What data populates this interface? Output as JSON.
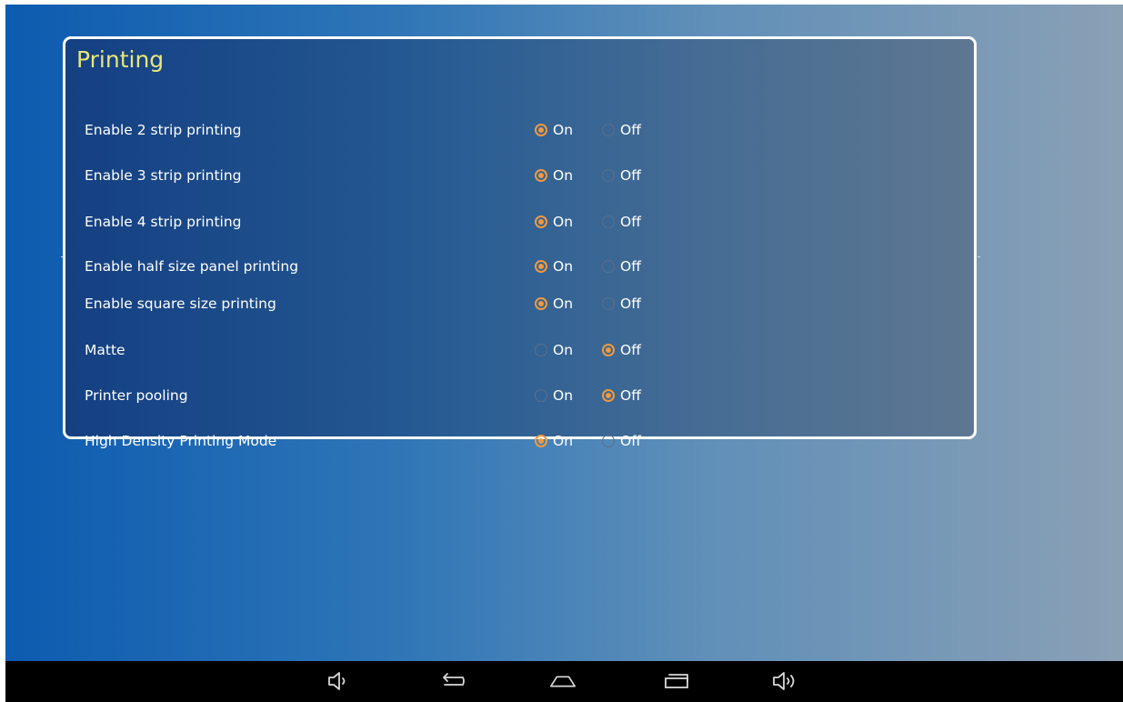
{
  "panel": {
    "title": "Printing"
  },
  "settings": [
    {
      "label": "Enable 2 strip printing",
      "on_label": "On",
      "off_label": "Off",
      "value": "On"
    },
    {
      "label": "Enable 3 strip printing",
      "on_label": "On",
      "off_label": "Off",
      "value": "On"
    },
    {
      "label": "Enable 4 strip printing",
      "on_label": "On",
      "off_label": "Off",
      "value": "On"
    },
    {
      "label": "Enable half size panel printing",
      "on_label": "On",
      "off_label": "Off",
      "value": "On"
    },
    {
      "label": "Enable square size printing",
      "on_label": "On",
      "off_label": "Off",
      "value": "On"
    },
    {
      "label": "Matte",
      "on_label": "On",
      "off_label": "Off",
      "value": "Off"
    },
    {
      "label": "Printer pooling",
      "on_label": "On",
      "off_label": "Off",
      "value": "Off"
    },
    {
      "label": "High Density Printing Mode",
      "on_label": "On",
      "off_label": "Off",
      "value": "On"
    }
  ],
  "navbar": {
    "buttons": [
      "volume-down-icon",
      "back-icon",
      "home-icon",
      "recent-apps-icon",
      "volume-up-icon"
    ]
  },
  "colors": {
    "accent": "#f09a3e",
    "title": "#e8e67a",
    "panel_border": "#ffffff",
    "navbar": "#000000"
  }
}
